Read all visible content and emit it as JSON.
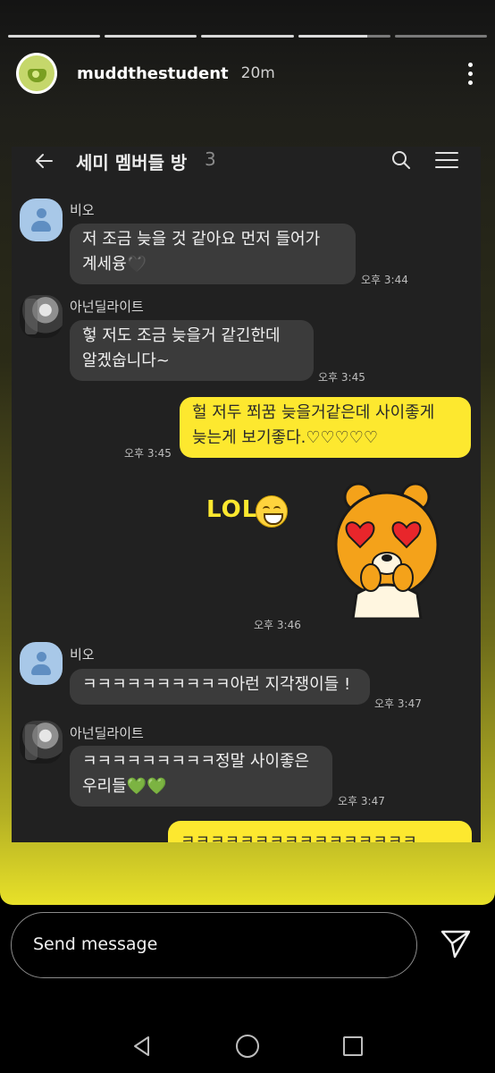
{
  "story": {
    "username": "muddthestudent",
    "time_ago": "20m",
    "progress_segments": [
      1,
      1,
      1,
      0.75,
      0
    ]
  },
  "chat": {
    "room_title": "세미 멤버들 방",
    "member_count": "3",
    "messages": [
      {
        "sender": "비오",
        "text_lines": [
          "저 조금 늦을 것 같아요 먼저 들어가",
          "계세융🖤"
        ],
        "time": "오후 3:44"
      },
      {
        "sender": "아넌딜라이트",
        "text_lines": [
          "헣 저도 조금 늦을거 같긴한데",
          "알겠숩니다~"
        ],
        "time": "오후 3:45"
      },
      {
        "sender": "me",
        "text_lines": [
          "헐 저두 쬐꿈 늦을거같은데 사이좋게",
          "늦는게 보기좋다.♡♡♡♡♡"
        ],
        "time": "오후 3:45"
      },
      {
        "sender": "me",
        "text_lines": [
          "LOL"
        ],
        "time": "오후 3:46"
      },
      {
        "sender": "비오",
        "text_lines": [
          "ㅋㅋㅋㅋㅋㅋㅋㅋㅋㅋ아런 지각쟁이들 !"
        ],
        "time": "오후 3:47"
      },
      {
        "sender": "아넌딜라이트",
        "text_lines": [
          "ㅋㅋㅋㅋㅋㅋㅋㅋㅋ정말 사이좋은",
          "우리들💚💚"
        ],
        "time": "오후 3:47"
      },
      {
        "sender": "me",
        "text_lines": [
          "ㅋㅋㅋㅋㅋㅋㅋㅋㅋㅋㅋㅋㅋㅋㅋㅋ"
        ],
        "time": ""
      }
    ]
  },
  "composer": {
    "placeholder": "Send message"
  },
  "icons": {
    "more": "kebab-menu-icon",
    "back": "back-arrow-icon",
    "search": "search-icon",
    "menu": "hamburger-menu-icon",
    "send": "send-icon",
    "nav_back": "nav-back-icon",
    "nav_home": "nav-home-icon",
    "nav_recents": "nav-recents-icon"
  },
  "colors": {
    "my_bubble": "#fde82f",
    "their_bubble": "#3b3b3b",
    "chat_background": "#212121"
  }
}
